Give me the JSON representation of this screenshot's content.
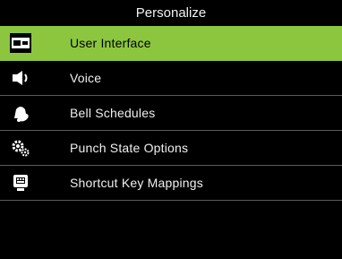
{
  "header": {
    "title": "Personalize"
  },
  "menu": {
    "items": [
      {
        "label": "User Interface",
        "icon": "monitor-icon",
        "selected": true
      },
      {
        "label": "Voice",
        "icon": "speaker-icon",
        "selected": false
      },
      {
        "label": "Bell Schedules",
        "icon": "bell-icon",
        "selected": false
      },
      {
        "label": "Punch State Options",
        "icon": "gears-icon",
        "selected": false
      },
      {
        "label": "Shortcut Key Mappings",
        "icon": "keyboard-icon",
        "selected": false
      }
    ]
  },
  "colors": {
    "highlight": "#8cc63f",
    "background": "#000000",
    "divider": "#5a5a5a",
    "text": "#f0f0f0"
  }
}
